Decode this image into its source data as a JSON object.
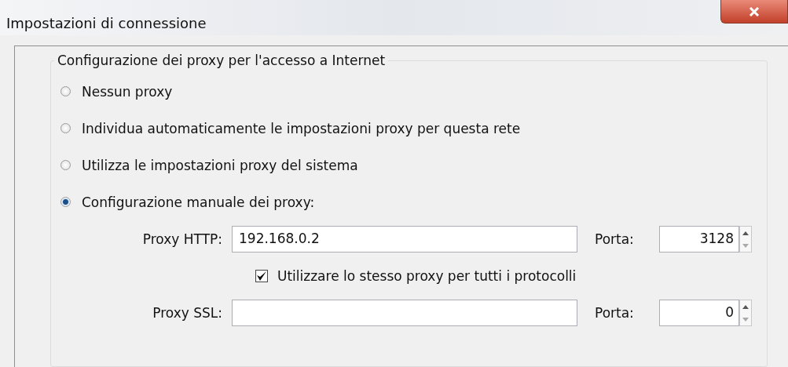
{
  "window": {
    "title": "Impostazioni di connessione"
  },
  "group": {
    "title": "Configurazione dei proxy per l'accesso a Internet"
  },
  "options": [
    {
      "label": "Nessun proxy",
      "selected": false
    },
    {
      "label": "Individua automaticamente le impostazioni proxy per questa rete",
      "selected": false
    },
    {
      "label": "Utilizza le impostazioni proxy del sistema",
      "selected": false
    },
    {
      "label": "Configurazione manuale dei proxy:",
      "selected": true
    }
  ],
  "proxy_rows": [
    {
      "kind": "field",
      "label": "Proxy HTTP:",
      "value": "192.168.0.2",
      "port_label": "Porta:",
      "port_value": "3128"
    },
    {
      "kind": "checkbox",
      "label": "Utilizzare lo stesso proxy per tutti i protocolli",
      "checked": true
    },
    {
      "kind": "field",
      "label": "Proxy SSL:",
      "port_label": "Porta:",
      "port_value": "0"
    }
  ]
}
